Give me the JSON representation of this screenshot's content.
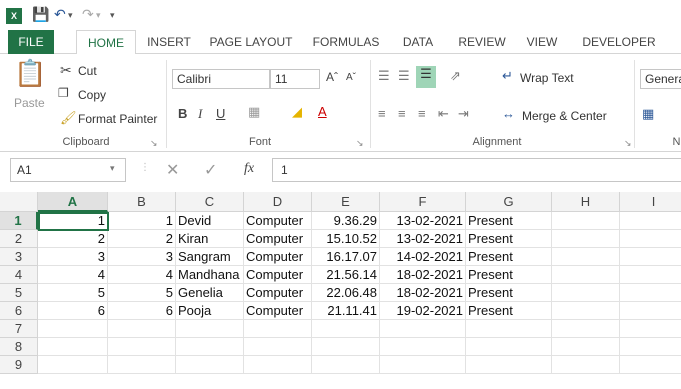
{
  "app": {
    "icon_text": "X"
  },
  "tabs": [
    {
      "label": "FILE"
    },
    {
      "label": "HOME"
    },
    {
      "label": "INSERT"
    },
    {
      "label": "PAGE LAYOUT"
    },
    {
      "label": "FORMULAS"
    },
    {
      "label": "DATA"
    },
    {
      "label": "REVIEW"
    },
    {
      "label": "VIEW"
    },
    {
      "label": "DEVELOPER"
    }
  ],
  "ribbon": {
    "clipboard": {
      "paste": "Paste",
      "cut": "Cut",
      "copy": "Copy",
      "format_painter": "Format Painter",
      "label": "Clipboard"
    },
    "font": {
      "name": "Calibri",
      "size": "11",
      "label": "Font"
    },
    "alignment": {
      "wrap": "Wrap Text",
      "merge": "Merge & Center",
      "label": "Alignment"
    },
    "number": {
      "format": "Genera",
      "label": "N"
    }
  },
  "formula_bar": {
    "name_box": "A1",
    "fx": "fx",
    "value": "1"
  },
  "columns": [
    "A",
    "B",
    "C",
    "D",
    "E",
    "F",
    "G",
    "H",
    "I"
  ],
  "rows": [
    "1",
    "2",
    "3",
    "4",
    "5",
    "6",
    "7",
    "8",
    "9"
  ],
  "data": [
    [
      "1",
      "1",
      "Devid",
      "Computer",
      "9.36.29",
      "13-02-2021",
      "Present"
    ],
    [
      "2",
      "2",
      "Kiran",
      "Computer",
      "15.10.52",
      "13-02-2021",
      "Present"
    ],
    [
      "3",
      "3",
      "Sangram",
      "Computer",
      "16.17.07",
      "14-02-2021",
      "Present"
    ],
    [
      "4",
      "4",
      "Mandhana",
      "Computer",
      "21.56.14",
      "18-02-2021",
      "Present"
    ],
    [
      "5",
      "5",
      "Genelia",
      "Computer",
      "22.06.48",
      "18-02-2021",
      "Present"
    ],
    [
      "6",
      "6",
      "Pooja",
      "Computer",
      "21.11.41",
      "19-02-2021",
      "Present"
    ]
  ],
  "colors": {
    "accent": "#217346"
  }
}
